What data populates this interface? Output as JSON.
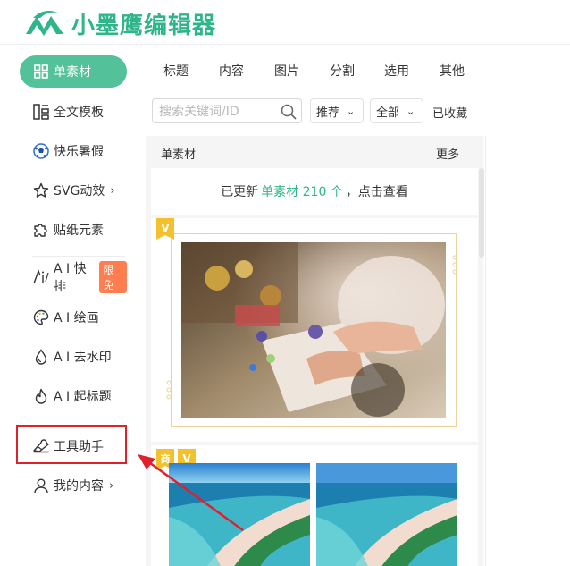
{
  "brand": {
    "name": "小墨鹰编辑器",
    "color": "#2fb58a"
  },
  "sidebar": {
    "items": [
      {
        "label": "单素材",
        "icon": "grid-icon",
        "active": true
      },
      {
        "label": "全文模板",
        "icon": "layout-icon"
      },
      {
        "label": "快乐暑假",
        "icon": "soccer-ball-icon"
      },
      {
        "label": "SVG动效",
        "icon": "star-icon",
        "chevron": "›"
      },
      {
        "label": "贴纸元素",
        "icon": "puzzle-icon"
      },
      {
        "label": "A I 快排",
        "icon": "ai-icon",
        "badge": "限免"
      },
      {
        "label": "A I 绘画",
        "icon": "palette-icon"
      },
      {
        "label": "A I 去水印",
        "icon": "water-drop-icon"
      },
      {
        "label": "A I 起标题",
        "icon": "flame-icon"
      },
      {
        "label": "工具助手",
        "icon": "tools-icon"
      },
      {
        "label": "我的内容",
        "icon": "user-icon",
        "chevron": "›"
      }
    ]
  },
  "nav": {
    "tabs": [
      "标题",
      "内容",
      "图片",
      "分割",
      "选用",
      "其他"
    ]
  },
  "search": {
    "placeholder": "搜索关键词/ID"
  },
  "filters": {
    "sort": "推荐",
    "scope": "全部",
    "favorites": "已收藏",
    "chevron": "⌄"
  },
  "section": {
    "title": "单素材",
    "more": "更多",
    "update_prefix": "已更新",
    "update_highlight": "单素材 210 个",
    "update_suffix": "，点击查看"
  },
  "cards": [
    {
      "badges": [
        "V"
      ]
    },
    {
      "badges": [
        "商",
        "V"
      ]
    }
  ],
  "colors": {
    "accent": "#53c19a",
    "badge": "#ff7d4f",
    "annotation": "#e0202a",
    "frame": "#ead49a",
    "vip": "#f3c12e"
  }
}
